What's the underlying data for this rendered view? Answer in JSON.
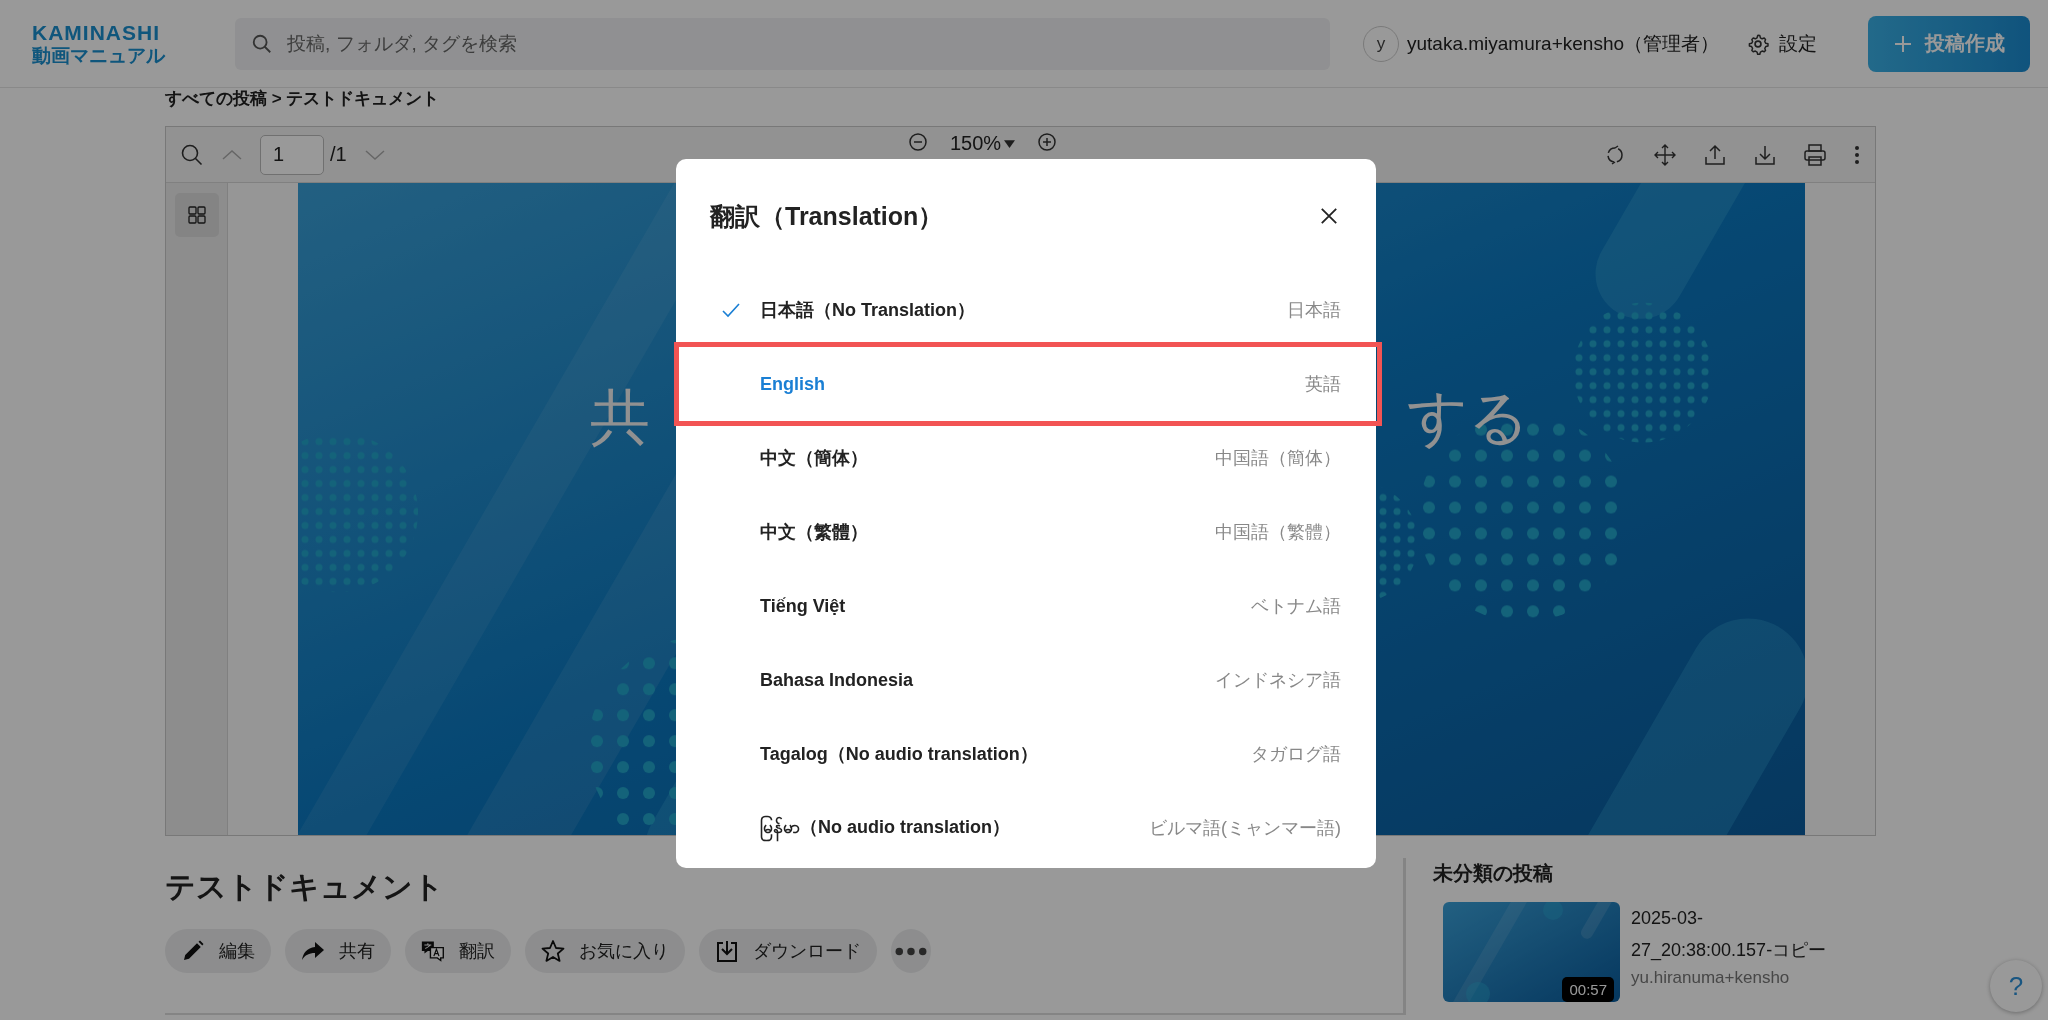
{
  "header": {
    "logo_top": "KAMINASHI",
    "logo_bottom": "動画マニュアル",
    "search": {
      "placeholder": "投稿, フォルダ, タグを検索"
    },
    "user": {
      "avatar_letter": "y",
      "name": "yutaka.miyamura+kensho（管理者）"
    },
    "settings": "設定",
    "create_button": "投稿作成"
  },
  "breadcrumb": "すべての投稿 > テストドキュメント",
  "viewer": {
    "page_input": "1",
    "page_total": "/1",
    "zoom": "150%",
    "slide_text_left": "共",
    "slide_text_right": "する"
  },
  "document": {
    "title": "テストドキュメント",
    "actions": [
      {
        "kind": "edit",
        "label": "編集"
      },
      {
        "kind": "share",
        "label": "共有"
      },
      {
        "kind": "translate",
        "label": "翻訳"
      },
      {
        "kind": "favorite",
        "label": "お気に入り"
      },
      {
        "kind": "download",
        "label": "ダウンロード"
      },
      {
        "kind": "more"
      }
    ]
  },
  "sidebar": {
    "heading": "未分類の投稿",
    "posts": [
      {
        "title": "2025-03-27_20:38:00.157-コピー",
        "author": "yu.hiranuma+kensho",
        "duration": "00:57"
      }
    ]
  },
  "help_button": "?",
  "modal": {
    "title": "翻訳（Translation）",
    "options": [
      {
        "label": "日本語（No Translation）",
        "native": "日本語",
        "checked": true,
        "selected": false,
        "highlighted": false
      },
      {
        "label": "English",
        "native": "英語",
        "checked": false,
        "selected": true,
        "highlighted": true
      },
      {
        "label": "中文（簡体）",
        "native": "中国語（簡体）",
        "checked": false,
        "selected": false,
        "highlighted": false
      },
      {
        "label": "中文（繁體）",
        "native": "中国語（繁體）",
        "checked": false,
        "selected": false,
        "highlighted": false
      },
      {
        "label": "Tiếng Việt",
        "native": "ベトナム語",
        "checked": false,
        "selected": false,
        "highlighted": false
      },
      {
        "label": "Bahasa Indonesia",
        "native": "インドネシア語",
        "checked": false,
        "selected": false,
        "highlighted": false
      },
      {
        "label": "Tagalog（No audio translation）",
        "native": "タガログ語",
        "checked": false,
        "selected": false,
        "highlighted": false
      },
      {
        "label": "မြန်မာ（No audio translation）",
        "native": "ビルマ語(ミャンマー語)",
        "checked": false,
        "selected": false,
        "highlighted": false
      }
    ]
  }
}
